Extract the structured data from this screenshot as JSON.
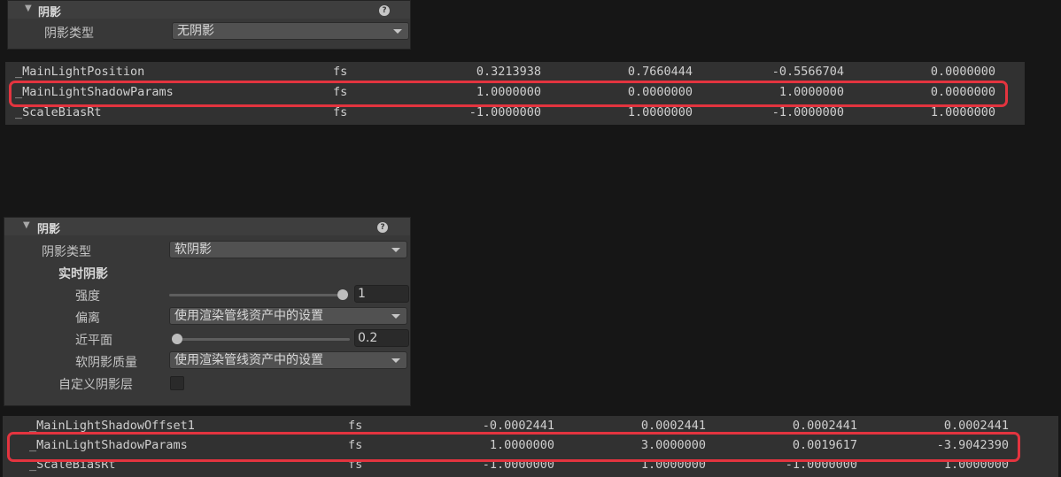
{
  "top_panel": {
    "title": "阴影",
    "help": "?",
    "shadow_type_label": "阴影类型",
    "shadow_type_value": "无阴影"
  },
  "table_top": {
    "rows": [
      {
        "name": "_MainLightPosition",
        "type": "fs",
        "v1": "0.3213938",
        "v2": "0.7660444",
        "v3": "-0.5566704",
        "v4": "0.0000000"
      },
      {
        "name": "_MainLightShadowParams",
        "type": "fs",
        "v1": "1.0000000",
        "v2": "0.0000000",
        "v3": "1.0000000",
        "v4": "0.0000000"
      },
      {
        "name": "_ScaleBiasRt",
        "type": "fs",
        "v1": "-1.0000000",
        "v2": "1.0000000",
        "v3": "-1.0000000",
        "v4": "1.0000000"
      }
    ]
  },
  "bottom_panel": {
    "title": "阴影",
    "help": "?",
    "shadow_type_label": "阴影类型",
    "shadow_type_value": "软阴影",
    "realtime_header": "实时阴影",
    "strength_label": "强度",
    "strength_value": "1",
    "strength_slider_fraction": 1.0,
    "bias_label": "偏离",
    "bias_value": "使用渲染管线资产中的设置",
    "near_plane_label": "近平面",
    "near_plane_value": "0.2",
    "near_plane_slider_fraction": 0.0,
    "soft_quality_label": "软阴影质量",
    "soft_quality_value": "使用渲染管线资产中的设置",
    "custom_layers_label": "自定义阴影层",
    "custom_layers_checked": false
  },
  "table_bottom": {
    "rows": [
      {
        "name": "_MainLightShadowOffset1",
        "type": "fs",
        "v1": "-0.0002441",
        "v2": "0.0002441",
        "v3": "0.0002441",
        "v4": "0.0002441"
      },
      {
        "name": "_MainLightShadowParams",
        "type": "fs",
        "v1": "1.0000000",
        "v2": "3.0000000",
        "v3": "0.0019617",
        "v4": "-3.9042390"
      },
      {
        "name": "_ScaleBiasRt",
        "type": "fs",
        "v1": "-1.0000000",
        "v2": "1.0000000",
        "v3": "-1.0000000",
        "v4": "1.0000000"
      }
    ]
  },
  "colors": {
    "highlight": "#e3343f",
    "panel": "#383838",
    "background": "#161616"
  }
}
